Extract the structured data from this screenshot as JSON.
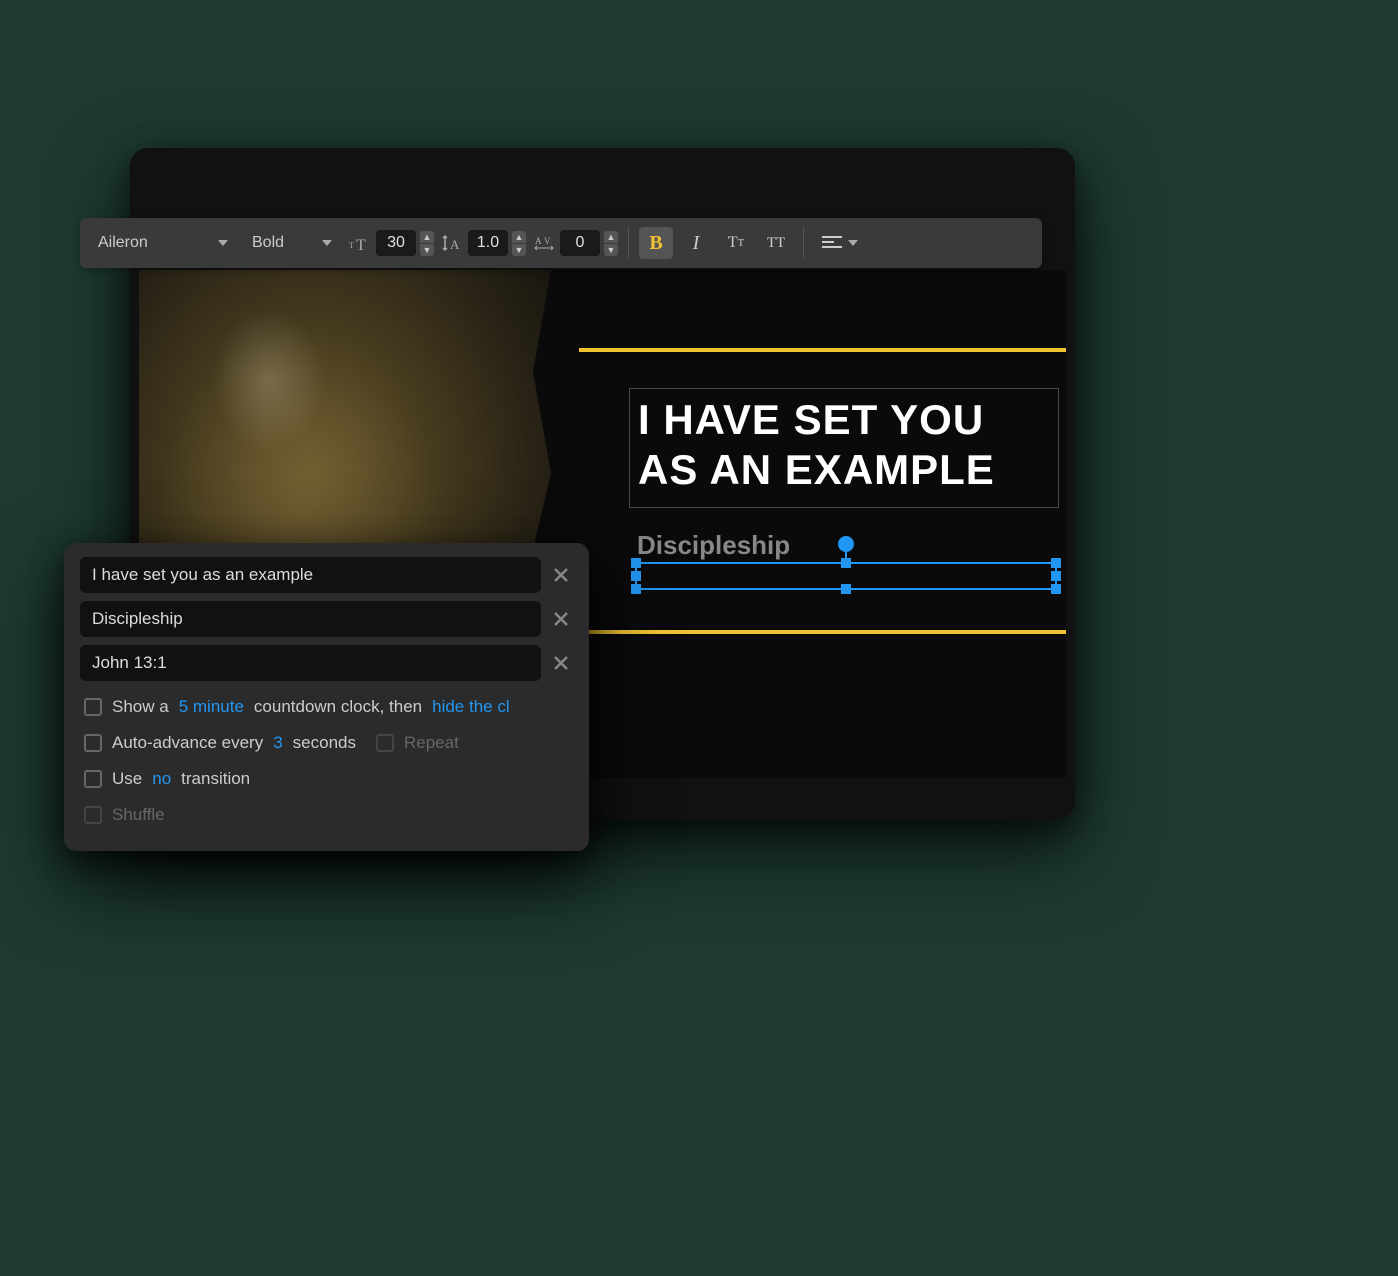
{
  "toolbar": {
    "font_family": "Aileron",
    "font_weight": "Bold",
    "font_size": "30",
    "line_height": "1.0",
    "letter_spacing": "0",
    "bold_label": "B",
    "italic_label": "I",
    "case_mixed_label": "Tᴛ",
    "case_upper_label": "TT"
  },
  "slide": {
    "title": "I HAVE SET YOU AS AN EXAMPLE",
    "subtitle": "Discipleship",
    "accent_color": "#f1c232"
  },
  "panel": {
    "text_fields": [
      "I have set you as an example",
      "Discipleship",
      "John 13:1"
    ],
    "option_countdown": {
      "prefix": "Show a",
      "duration": "5 minute",
      "mid": "countdown clock, then",
      "action": "hide the cl"
    },
    "option_autoadvance": {
      "prefix": "Auto-advance every",
      "seconds": "3",
      "suffix": "seconds",
      "repeat_label": "Repeat"
    },
    "option_transition": {
      "prefix": "Use",
      "type": "no",
      "suffix": "transition"
    },
    "option_shuffle": "Shuffle"
  }
}
